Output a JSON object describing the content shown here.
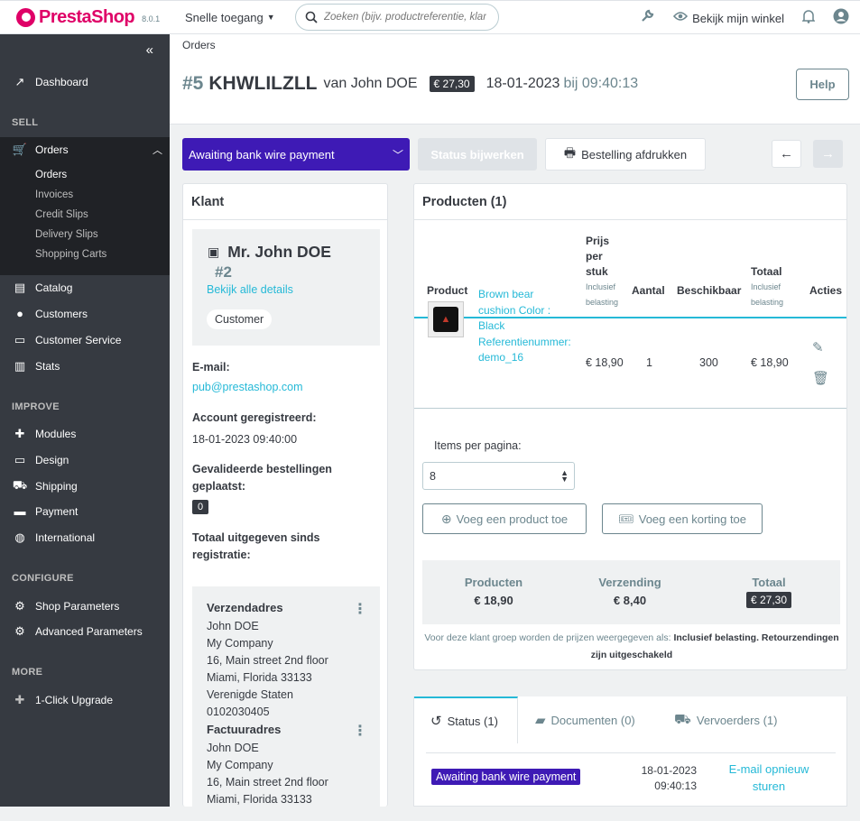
{
  "topbar": {
    "brand": "PrestaShop",
    "version": "8.0.1",
    "quick_access": "Snelle toegang",
    "search_placeholder": "Zoeken (bijv. productreferentie, klantnaam...)",
    "view_shop": "Bekijk mijn winkel"
  },
  "sidebar": {
    "dashboard": "Dashboard",
    "sell": "SELL",
    "orders": "Orders",
    "sub": [
      "Orders",
      "Invoices",
      "Credit Slips",
      "Delivery Slips",
      "Shopping Carts"
    ],
    "catalog": "Catalog",
    "customers": "Customers",
    "customer_service": "Customer Service",
    "stats": "Stats",
    "improve": "IMPROVE",
    "modules": "Modules",
    "design": "Design",
    "shipping": "Shipping",
    "payment": "Payment",
    "international": "International",
    "configure": "CONFIGURE",
    "shop_parameters": "Shop Parameters",
    "advanced_parameters": "Advanced Parameters",
    "more": "MORE",
    "upgrade": "1-Click Upgrade"
  },
  "header": {
    "breadcrumb": "Orders",
    "order_number": "#5",
    "reference": "KHWLILZLL",
    "by": "van John DOE",
    "total": "€ 27,30",
    "date": "18-01-2023",
    "time": "bij 09:40:13",
    "help": "Help"
  },
  "actions": {
    "status": "Awaiting bank wire payment",
    "update_status": "Status bijwerken",
    "print": "Bestelling afdrukken"
  },
  "customer": {
    "card_title": "Klant",
    "name": "Mr. John DOE",
    "id": "#2",
    "details_link": "Bekijk alle details",
    "group": "Customer",
    "email_label": "E-mail:",
    "email": "pub@prestashop.com",
    "registered_label": "Account geregistreerd:",
    "registered": "18-01-2023 09:40:00",
    "valid_orders_label_1": "Gevalideerde bestellingen",
    "valid_orders_label_2": "geplaatst:",
    "valid_orders": "0",
    "spent_label_1": "Totaal uitgegeven sinds",
    "spent_label_2": "registratie:",
    "shipping_title": "Verzendadres",
    "shipping_lines": [
      "John DOE",
      "My Company",
      "16, Main street 2nd floor",
      "Miami, Florida 33133",
      "Verenigde Staten",
      "0102030405"
    ],
    "invoice_title": "Factuuradres",
    "invoice_lines": [
      "John DOE",
      "My Company",
      "16, Main street 2nd floor",
      "Miami, Florida 33133"
    ]
  },
  "products": {
    "card_title": "Producten (1)",
    "col_product": "Product",
    "col_price_1": "Prijs",
    "col_price_2": "per",
    "col_price_3": "stuk",
    "tax_incl_1": "Inclusief",
    "tax_incl_2": "belasting",
    "col_qty": "Aantal",
    "col_available": "Beschikbaar",
    "col_total": "Totaal",
    "col_actions": "Acties",
    "item": {
      "name_lines": [
        "Brown bear",
        "cushion Color :",
        "Black",
        "Referentienummer:",
        "demo_16"
      ],
      "price": "€ 18,90",
      "qty": "1",
      "available": "300",
      "total": "€ 18,90"
    },
    "per_page_label": "Items per pagina:",
    "per_page": "8",
    "add_product": "Voeg een product toe",
    "add_discount": "Voeg een korting toe",
    "sum_products_label": "Producten",
    "sum_products": "€ 18,90",
    "sum_shipping_label": "Verzending",
    "sum_shipping": "€ 8,40",
    "sum_total_label": "Totaal",
    "sum_total": "€ 27,30",
    "note_prefix": "Voor deze klant groep worden de prijzen weergegeven als:",
    "note_tax": "Inclusief belasting",
    "note_returns": "Retourzendingen zijn uitgeschakeld"
  },
  "history": {
    "tab_status": "Status (1)",
    "tab_documents": "Documenten (0)",
    "tab_carriers": "Vervoerders (1)",
    "row_status": "Awaiting bank wire payment",
    "row_date": "18-01-2023",
    "row_time": "09:40:13",
    "resend": "E-mail opnieuw sturen"
  },
  "colors": {
    "accent": "#25b9d7",
    "status": "#3e1ab5",
    "sidebar": "#363a41",
    "brand": "#df0067"
  }
}
